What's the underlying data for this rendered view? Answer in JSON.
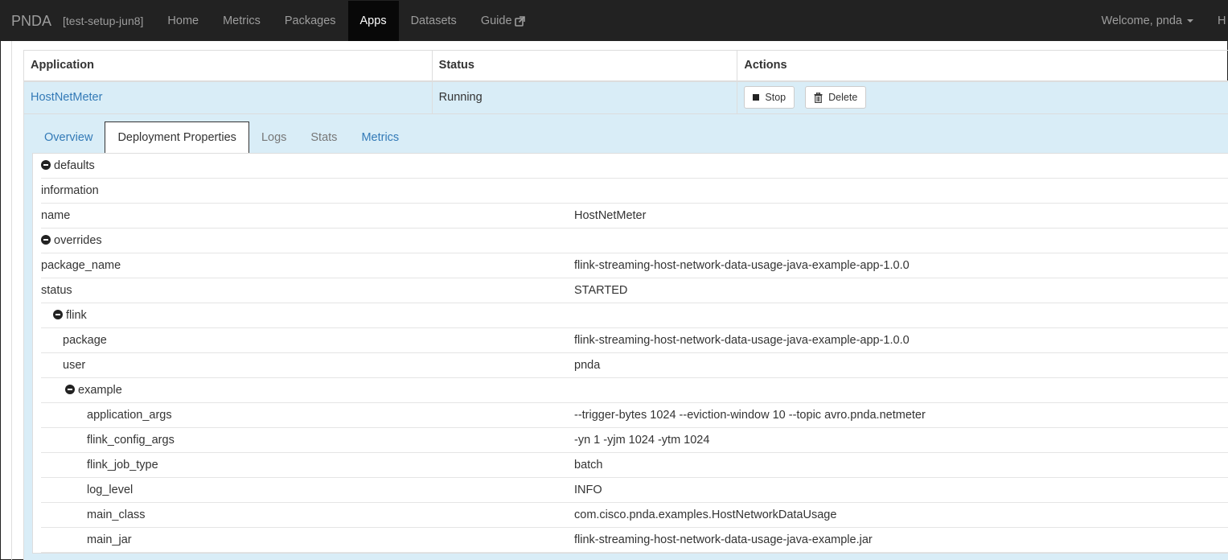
{
  "navbar": {
    "brand": "PNDA",
    "cluster": "[test-setup-jun8]",
    "items": [
      {
        "label": "Home",
        "active": false
      },
      {
        "label": "Metrics",
        "active": false
      },
      {
        "label": "Packages",
        "active": false
      },
      {
        "label": "Apps",
        "active": true
      },
      {
        "label": "Datasets",
        "active": false
      },
      {
        "label": "Guide",
        "active": false,
        "icon": "external-link-icon"
      }
    ],
    "welcome": "Welcome, pnda",
    "help_partial": "H"
  },
  "table": {
    "headers": [
      "Application",
      "Status",
      "Actions"
    ],
    "row": {
      "application": "HostNetMeter",
      "status": "Running",
      "stop_label": "Stop",
      "delete_label": "Delete"
    }
  },
  "tabs": [
    {
      "label": "Overview"
    },
    {
      "label": "Deployment Properties",
      "active": true
    },
    {
      "label": "Logs"
    },
    {
      "label": "Stats"
    },
    {
      "label": "Metrics"
    }
  ],
  "properties": [
    {
      "key": "defaults",
      "value": "",
      "collapsible": true,
      "level": 0
    },
    {
      "key": "information",
      "value": "",
      "level": 0
    },
    {
      "key": "name",
      "value": "HostNetMeter",
      "level": 0
    },
    {
      "key": "overrides",
      "value": "",
      "collapsible": true,
      "level": 0
    },
    {
      "key": "package_name",
      "value": "flink-streaming-host-network-data-usage-java-example-app-1.0.0",
      "level": 0
    },
    {
      "key": "status",
      "value": "STARTED",
      "level": 0
    },
    {
      "key": "flink",
      "value": "",
      "collapsible": true,
      "level": 1
    },
    {
      "key": "package",
      "value": "flink-streaming-host-network-data-usage-java-example-app-1.0.0",
      "level": 1
    },
    {
      "key": "user",
      "value": "pnda",
      "level": 1
    },
    {
      "key": "example",
      "value": "",
      "collapsible": true,
      "level": 2
    },
    {
      "key": "application_args",
      "value": "--trigger-bytes 1024 --eviction-window 10 --topic avro.pnda.netmeter",
      "level": 2
    },
    {
      "key": "flink_config_args",
      "value": "-yn 1 -yjm 1024 -ytm 1024",
      "level": 2
    },
    {
      "key": "flink_job_type",
      "value": "batch",
      "level": 2
    },
    {
      "key": "log_level",
      "value": "INFO",
      "level": 2
    },
    {
      "key": "main_class",
      "value": "com.cisco.pnda.examples.HostNetworkDataUsage",
      "level": 2
    },
    {
      "key": "main_jar",
      "value": "flink-streaming-host-network-data-usage-java-example.jar",
      "level": 2
    }
  ],
  "colors": {
    "navbar_bg": "#222222",
    "link": "#337ab7",
    "row_highlight": "#d9edf7"
  }
}
